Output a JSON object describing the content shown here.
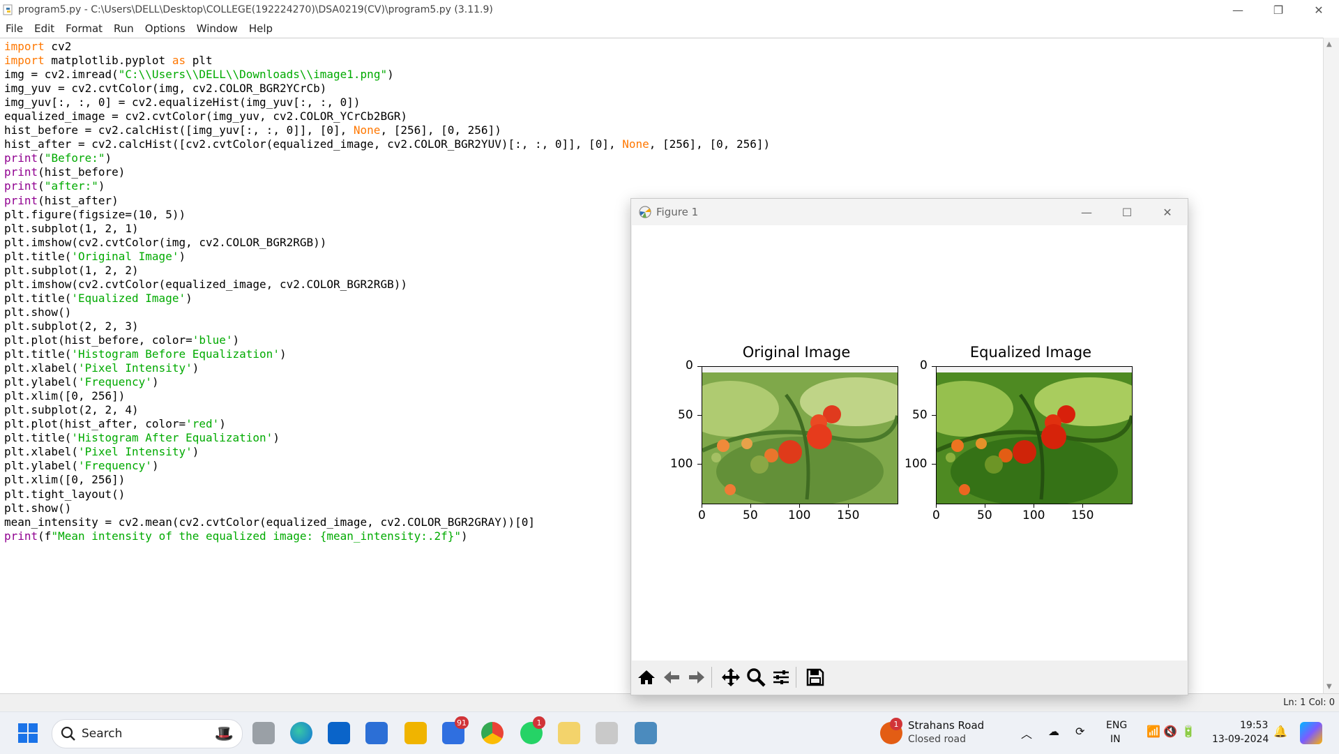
{
  "window": {
    "title": "program5.py - C:\\Users\\DELL\\Desktop\\COLLEGE(192224270)\\DSA0219(CV)\\program5.py (3.11.9)",
    "minimize": "—",
    "maximize": "❐",
    "close": "✕"
  },
  "menu": [
    "File",
    "Edit",
    "Format",
    "Run",
    "Options",
    "Window",
    "Help"
  ],
  "code_lines": [
    "import cv2",
    "import matplotlib.pyplot as plt",
    "img = cv2.imread(\"C:\\\\Users\\\\DELL\\\\Downloads\\\\image1.png\")",
    "img_yuv = cv2.cvtColor(img, cv2.COLOR_BGR2YCrCb)",
    "img_yuv[:, :, 0] = cv2.equalizeHist(img_yuv[:, :, 0])",
    "equalized_image = cv2.cvtColor(img_yuv, cv2.COLOR_YCrCb2BGR)",
    "hist_before = cv2.calcHist([img_yuv[:, :, 0]], [0], None, [256], [0, 256])",
    "hist_after = cv2.calcHist([cv2.cvtColor(equalized_image, cv2.COLOR_BGR2YUV)[:, :, 0]], [0], None, [256], [0, 256])",
    "print(\"Before:\")",
    "print(hist_before)",
    "print(\"after:\")",
    "print(hist_after)",
    "plt.figure(figsize=(10, 5))",
    "plt.subplot(1, 2, 1)",
    "plt.imshow(cv2.cvtColor(img, cv2.COLOR_BGR2RGB))",
    "plt.title('Original Image')",
    "plt.subplot(1, 2, 2)",
    "plt.imshow(cv2.cvtColor(equalized_image, cv2.COLOR_BGR2RGB))",
    "plt.title('Equalized Image')",
    "plt.show()",
    "plt.subplot(2, 2, 3)",
    "plt.plot(hist_before, color='blue')",
    "plt.title('Histogram Before Equalization')",
    "plt.xlabel('Pixel Intensity')",
    "plt.ylabel('Frequency')",
    "plt.xlim([0, 256])",
    "plt.subplot(2, 2, 4)",
    "plt.plot(hist_after, color='red')",
    "plt.title('Histogram After Equalization')",
    "plt.xlabel('Pixel Intensity')",
    "plt.ylabel('Frequency')",
    "plt.xlim([0, 256])",
    "plt.tight_layout()",
    "plt.show()",
    "mean_intensity = cv2.mean(cv2.cvtColor(equalized_image, cv2.COLOR_BGR2GRAY))[0]",
    "print(f\"Mean intensity of the equalized image: {mean_intensity:.2f}\")"
  ],
  "syntax_colors": {
    "keyword": "#ff7700",
    "string": "#00aa00",
    "builtin": "#900090"
  },
  "status": {
    "position": "Ln: 1   Col: 0"
  },
  "figure": {
    "title": "Figure 1",
    "subplots": [
      {
        "title": "Original Image",
        "xticks": [
          "0",
          "50",
          "100",
          "150"
        ],
        "yticks": [
          "0",
          "50",
          "100"
        ]
      },
      {
        "title": "Equalized Image",
        "xticks": [
          "0",
          "50",
          "100",
          "150"
        ],
        "yticks": [
          "0",
          "50",
          "100"
        ]
      }
    ],
    "toolbar": [
      "home-icon",
      "back-icon",
      "forward-icon",
      "pan-icon",
      "zoom-icon",
      "configure-icon",
      "save-icon"
    ]
  },
  "taskbar": {
    "search_label": "Search",
    "chrome_badge": "91",
    "whatsapp_badge": "1",
    "weather_badge": "1",
    "weather_title": "Strahans Road",
    "weather_subtitle": "Closed road",
    "lang_line1": "ENG",
    "lang_line2": "IN",
    "time": "19:53",
    "date": "13-09-2024"
  }
}
